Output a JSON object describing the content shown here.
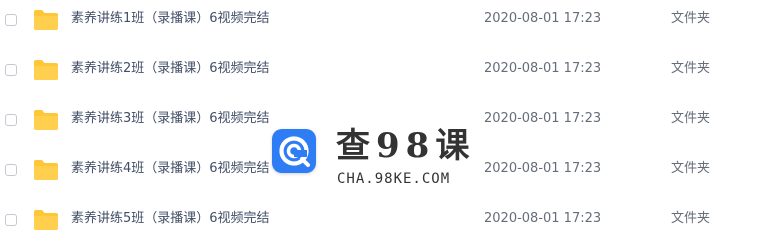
{
  "files": [
    {
      "name": "素养讲练1班（录播课）6视频完结",
      "date": "2020-08-01 17:23",
      "type": "文件夹"
    },
    {
      "name": "素养讲练2班（录播课）6视频完结",
      "date": "2020-08-01 17:23",
      "type": "文件夹"
    },
    {
      "name": "素养讲练3班（录播课）6视频完结",
      "date": "2020-08-01 17:23",
      "type": "文件夹"
    },
    {
      "name": "素养讲练4班（录播课）6视频完结",
      "date": "2020-08-01 17:23",
      "type": "文件夹"
    },
    {
      "name": "素养讲练5班（录播课）6视频完结",
      "date": "2020-08-01 17:23",
      "type": "文件夹"
    }
  ],
  "watermark": {
    "title": "查98课",
    "url": "CHA.98KE.COM",
    "logo_color": "#2f7df5"
  },
  "colors": {
    "folder": "#ffc637",
    "text": "#424e67",
    "meta": "#666d7a"
  }
}
